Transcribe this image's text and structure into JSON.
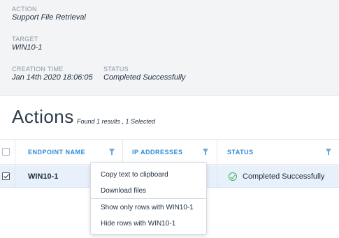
{
  "details": {
    "action": {
      "label": "ACTION",
      "value": "Support File Retrieval"
    },
    "target": {
      "label": "TARGET",
      "value": "WIN10-1"
    },
    "creation_time": {
      "label": "CREATION TIME",
      "value": "Jan 14th 2020 18:06:05"
    },
    "status": {
      "label": "STATUS",
      "value": "Completed Successfully"
    }
  },
  "section": {
    "title": "Actions",
    "summary": "Found 1 results , 1 Selected"
  },
  "table": {
    "columns": [
      "ENDPOINT NAME",
      "IP ADDRESSES",
      "STATUS"
    ],
    "rows": [
      {
        "selected": true,
        "endpoint_name": "WIN10-1",
        "ip_addresses": "",
        "status": "Completed Successfully"
      }
    ]
  },
  "context_menu": {
    "items": [
      "Copy text to clipboard",
      "Download files",
      "Show only rows with WIN10-1",
      "Hide rows with WIN10-1"
    ]
  },
  "colors": {
    "accent": "#2e8bd6",
    "selected_row": "#e8f1fb",
    "success": "#3cab5c",
    "details_bg": "#f2f4f6"
  },
  "icons": [
    "filter-icon",
    "checkbox-icon",
    "check-circle-icon"
  ]
}
